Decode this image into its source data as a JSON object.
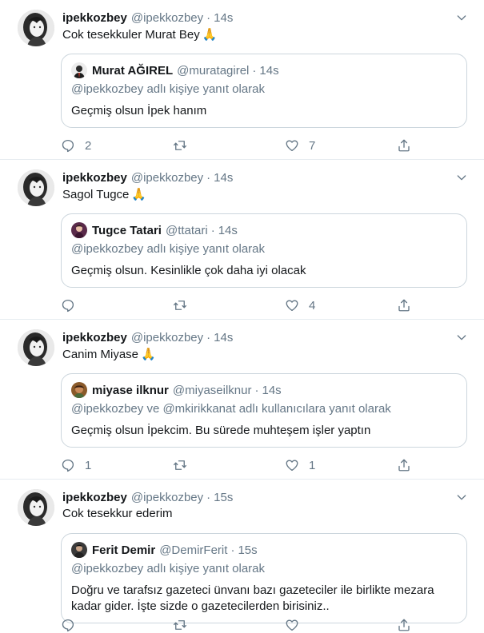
{
  "tweets": [
    {
      "name": "ipekkozbey",
      "handle": "@ipekkozbey",
      "time": "14s",
      "text": "Cok tesekkuler Murat Bey",
      "emoji": "🙏",
      "quote": {
        "name": "Murat AĞIREL",
        "handle": "@muratagirel",
        "time": "14s",
        "reply_to": "@ipekkozbey adlı kişiye yanıt olarak",
        "text": "Geçmiş olsun İpek hanım"
      },
      "replies": "2",
      "retweets": "",
      "likes": "7"
    },
    {
      "name": "ipekkozbey",
      "handle": "@ipekkozbey",
      "time": "14s",
      "text": "Sagol Tugce",
      "emoji": "🙏",
      "quote": {
        "name": "Tugce Tatari",
        "handle": "@ttatari",
        "time": "14s",
        "reply_to": "@ipekkozbey adlı kişiye yanıt olarak",
        "text": "Geçmiş olsun. Kesinlikle çok daha iyi olacak"
      },
      "replies": "",
      "retweets": "",
      "likes": "4"
    },
    {
      "name": "ipekkozbey",
      "handle": "@ipekkozbey",
      "time": "14s",
      "text": "Canim Miyase",
      "emoji": "🙏",
      "quote": {
        "name": "miyase ilknur",
        "handle": "@miyaseilknur",
        "time": "14s",
        "reply_to": "@ipekkozbey ve @mkirikkanat adlı kullanıcılara yanıt olarak",
        "text": "Geçmiş olsun İpekcim. Bu sürede muhteşem işler yaptın"
      },
      "replies": "1",
      "retweets": "",
      "likes": "1"
    },
    {
      "name": "ipekkozbey",
      "handle": "@ipekkozbey",
      "time": "15s",
      "text": "Cok tesekkur ederim",
      "emoji": "",
      "quote": {
        "name": "Ferit Demir",
        "handle": "@DemirFerit",
        "time": "15s",
        "reply_to": "@ipekkozbey adlı kişiye yanıt olarak",
        "text": "Doğru ve tarafsız gazeteci ünvanı  bazı gazeteciler ile birlikte mezara kadar gider.  İşte sizde o gazetecilerden birisiniz.."
      },
      "replies": "",
      "retweets": "",
      "likes": ""
    }
  ],
  "colors": {
    "text": "#14171a",
    "secondary": "#657786",
    "border": "#ccd6dd",
    "divider": "#e6ecf0"
  }
}
